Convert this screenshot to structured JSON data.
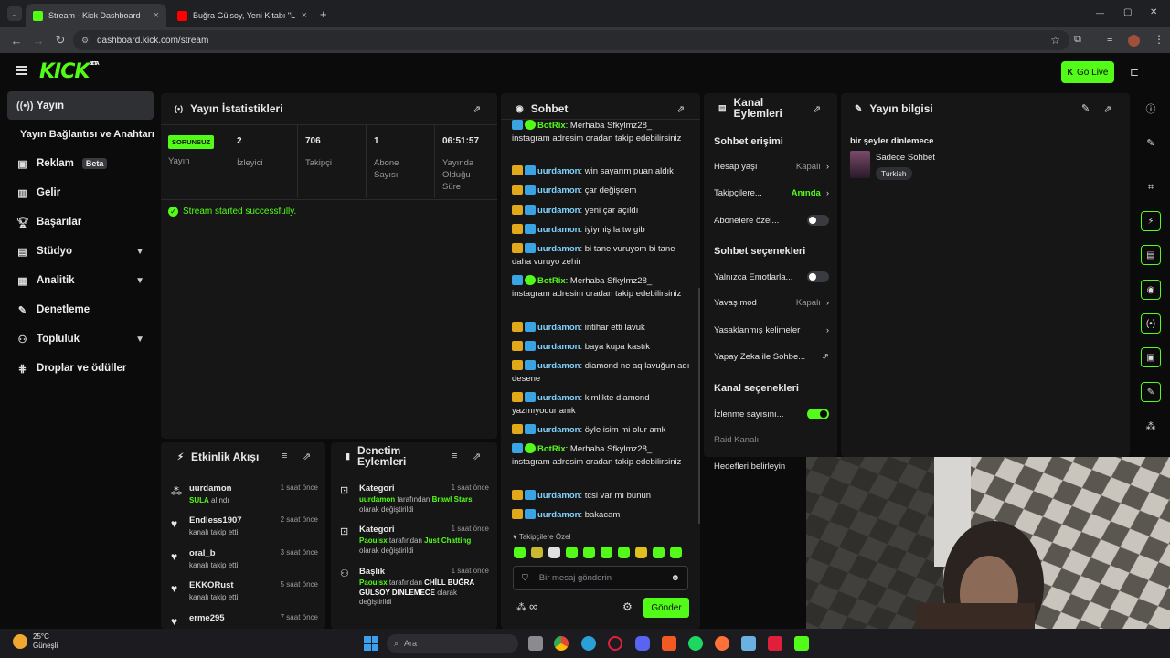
{
  "browser": {
    "tabs": [
      {
        "title": "Stream - Kick Dashboard",
        "close": "×"
      },
      {
        "title": "Buğra Gülsoy, Yeni Kitabı \"Luna",
        "close": "×"
      }
    ],
    "new_tab": "+",
    "url": "dashboard.kick.com/stream",
    "window_controls": [
      "—",
      "▢",
      "✕"
    ]
  },
  "header": {
    "logo": "KICK",
    "logo_sup": "BETA",
    "go_live": "Go Live"
  },
  "sidebar": {
    "items": [
      {
        "label": "Yayın",
        "icon": "broadcast-icon"
      },
      {
        "label": "Yayın Bağlantısı ve Anahtarı",
        "icon": ""
      },
      {
        "label": "Reklam",
        "icon": "ad-icon",
        "badge": "Beta"
      },
      {
        "label": "Gelir",
        "icon": "chart-icon"
      },
      {
        "label": "Başarılar",
        "icon": "trophy-icon"
      },
      {
        "label": "Stüdyo",
        "icon": "studio-icon"
      },
      {
        "label": "Analitik",
        "icon": "analytics-icon"
      },
      {
        "label": "Denetleme",
        "icon": "wrench-icon"
      },
      {
        "label": "Topluluk",
        "icon": "community-icon"
      },
      {
        "label": "Droplar ve ödüller",
        "icon": "drops-icon"
      }
    ]
  },
  "stats": {
    "title": "Yayın İstatistikleri",
    "status_badge": "SORUNSUZ",
    "status_label": "Yayın",
    "items": [
      {
        "value": "2",
        "label": "İzleyici"
      },
      {
        "value": "706",
        "label": "Takipçi"
      },
      {
        "value": "1",
        "label": "Abone Sayısı"
      },
      {
        "value": "06:51:57",
        "label": "Yayında Olduğu Süre"
      }
    ],
    "success": "Stream started successfully."
  },
  "activity": {
    "title": "Etkinlik Akışı",
    "events": [
      {
        "name": "uurdamon",
        "desc": "SULA",
        "desc2": " alındı",
        "time": "1 saat önce"
      },
      {
        "name": "Endless1907",
        "desc": "kanalı takip etti",
        "time": "2 saat önce"
      },
      {
        "name": "oral_b",
        "desc": "kanalı takip etti",
        "time": "3 saat önce"
      },
      {
        "name": "EKKORust",
        "desc": "kanalı takip etti",
        "time": "5 saat önce"
      },
      {
        "name": "erme295",
        "desc": "",
        "time": "7 saat önce"
      }
    ]
  },
  "moderation": {
    "title": "Denetim Eylemleri",
    "actions": [
      {
        "name": "Kategori",
        "user": "uurdamon",
        "mid": " tarafından ",
        "target": "Brawl Stars",
        "tail": " olarak değiştirildi",
        "time": "1 saat önce"
      },
      {
        "name": "Kategori",
        "user": "Paoulsx",
        "mid": " tarafından ",
        "target": "Just Chatting",
        "tail": " olarak değiştirildi",
        "time": "1 saat önce"
      },
      {
        "name": "Başlık",
        "user": "Paoulsx",
        "mid": " tarafından ",
        "target": "CHİLL BUĞRA GÜLSOY DİNLEMECE",
        "tail": " olarak değiştirildi",
        "time": "1 saat önce"
      }
    ]
  },
  "chat": {
    "title": "Sohbet",
    "messages": [
      {
        "user": "BotRix",
        "text": "Merhaba Sfkylmz28_ instagram adresim oradan takip edebilirsiniz",
        "bot": true
      },
      {
        "user": "uurdamon",
        "text": "win sayarım puan aldık"
      },
      {
        "user": "uurdamon",
        "text": "çar değişcem"
      },
      {
        "user": "uurdamon",
        "text": "yeni çar açıldı"
      },
      {
        "user": "uurdamon",
        "text": "iyiymiş la tw gib"
      },
      {
        "user": "uurdamon",
        "text": "bi tane vuruyom bi tane daha vuruyo zehir"
      },
      {
        "user": "BotRix",
        "text": "Merhaba Sfkylmz28_ instagram adresim oradan takip edebilirsiniz",
        "bot": true
      },
      {
        "user": "uurdamon",
        "text": "intihar etti lavuk"
      },
      {
        "user": "uurdamon",
        "text": "baya kupa kastık"
      },
      {
        "user": "uurdamon",
        "text": "diamond ne aq lavuğun adı desene"
      },
      {
        "user": "uurdamon",
        "text": "kimlikte diamond yazmıyodur amk"
      },
      {
        "user": "uurdamon",
        "text": "öyle isim mi olur amk"
      },
      {
        "user": "BotRix",
        "text": "Merhaba Sfkylmz28_ instagram adresim oradan takip edebilirsiniz",
        "bot": true
      },
      {
        "user": "uurdamon",
        "text": "tcsi var mı bunun"
      },
      {
        "user": "uurdamon",
        "text": "bakacam"
      }
    ],
    "followers_only": "Takipçilere Özel",
    "input_placeholder": "Bir mesaj gönderin",
    "send": "Gönder",
    "infinity": "∞"
  },
  "channel_actions": {
    "title1": "Kanal",
    "title2": "Eylemleri",
    "chat_access": "Sohbet erişimi",
    "account_age": {
      "label": "Hesap yaşı",
      "value": "Kapalı"
    },
    "followers": {
      "label": "Takipçilere...",
      "value": "Anında"
    },
    "subs": {
      "label": "Abonelere özel..."
    },
    "chat_options": "Sohbet seçenekleri",
    "emotes": {
      "label": "Yalnızca Emotlarla..."
    },
    "slow": {
      "label": "Yavaş mod",
      "value": "Kapalı"
    },
    "banned": {
      "label": "Yasaklanmış kelimeler"
    },
    "ai": {
      "label": "Yapay Zeka ile Sohbe..."
    },
    "channel_options": "Kanal seçenekleri",
    "viewer_count": {
      "label": "İzlenme sayısını..."
    },
    "raid": {
      "label": "Raid Kanalı"
    },
    "goals": {
      "label": "Hedefleri belirleyin"
    }
  },
  "stream_info": {
    "title": "Yayın bilgisi",
    "stream_title": "bir şeyler dinlemece",
    "category": "Sadece Sohbet",
    "language": "Turkish"
  },
  "taskbar": {
    "temp": "25°C",
    "weather": "Güneşli",
    "search": "Ara"
  },
  "colors": {
    "accent": "#53fc18",
    "bg": "#0b0b0c",
    "panel": "#161617",
    "blue_badge": "#3aa3e3",
    "crown": "#e2a81b"
  }
}
